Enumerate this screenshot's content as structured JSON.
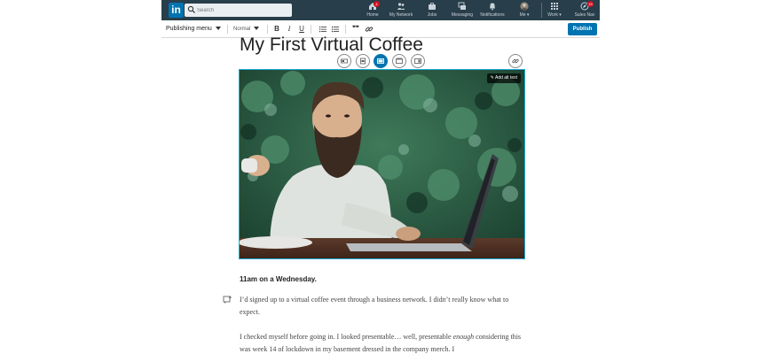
{
  "nav": {
    "logo": "in",
    "search_placeholder": "Search",
    "items": [
      {
        "label": "Home",
        "badge": "4",
        "icon": "home-icon"
      },
      {
        "label": "My Network",
        "icon": "network-icon"
      },
      {
        "label": "Jobs",
        "icon": "briefcase-icon"
      },
      {
        "label": "Messaging",
        "icon": "messaging-icon"
      },
      {
        "label": "Notifications",
        "icon": "bell-icon"
      },
      {
        "label": "Me",
        "icon": "avatar"
      },
      {
        "label": "Work",
        "icon": "grid-icon"
      },
      {
        "label": "Sales Nav",
        "badge": "15",
        "icon": "compass-icon"
      }
    ]
  },
  "toolbar": {
    "publishing_menu": "Publishing menu",
    "style_select": "Normal",
    "bold": "B",
    "italic": "I",
    "underline": "U",
    "quote": "❞❞",
    "publish": "Publish"
  },
  "article": {
    "title": "My First Virtual Coffee",
    "alt_text_button": "Add alt text",
    "subheading": "11am on a Wednesday.",
    "paragraph1": "I’d signed up to a virtual coffee event through a business network. I didn’t really know what to expect.",
    "paragraph2_pre": "I checked myself before going in. I looked presentable… well, presentable ",
    "paragraph2_em": "enough",
    "paragraph2_post": " considering this was week 14 of lockdown in my basement dressed in the company merch. I"
  },
  "colors": {
    "nav_bg": "#283e4a",
    "brand_blue": "#0073b1",
    "image_border": "#1fa9d6"
  }
}
